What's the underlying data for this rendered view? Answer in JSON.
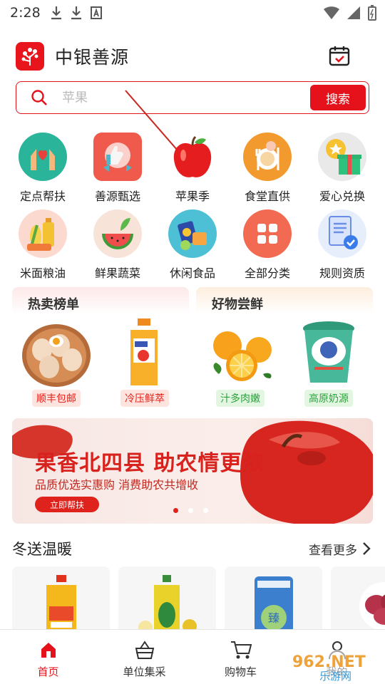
{
  "status_bar": {
    "time": "2:28",
    "icons": [
      "download-icon",
      "download-icon",
      "font-icon",
      "wifi-icon",
      "signal-icon",
      "battery-icon"
    ]
  },
  "header": {
    "title": "中银善源",
    "logo": "tree-logo",
    "action_icon": "calendar-check-icon"
  },
  "search": {
    "placeholder": "苹果",
    "button_label": "搜索"
  },
  "categories": [
    {
      "label": "定点帮扶",
      "icon": "helping-hands-icon"
    },
    {
      "label": "善源甄选",
      "icon": "thumbs-up-badge-icon"
    },
    {
      "label": "苹果季",
      "icon": "apple-icon"
    },
    {
      "label": "食堂直供",
      "icon": "dining-icon"
    },
    {
      "label": "爱心兑换",
      "icon": "gift-icon"
    },
    {
      "label": "米面粮油",
      "icon": "grain-oil-icon"
    },
    {
      "label": "鲜果蔬菜",
      "icon": "watermelon-icon"
    },
    {
      "label": "休闲食品",
      "icon": "snacks-icon"
    },
    {
      "label": "全部分类",
      "icon": "grid-icon"
    },
    {
      "label": "规则资质",
      "icon": "document-check-icon"
    }
  ],
  "promos": [
    {
      "title": "热卖榜单",
      "items": [
        {
          "tag": "顺丰包邮"
        },
        {
          "tag": "冷压鲜萃"
        }
      ]
    },
    {
      "title": "好物尝鲜",
      "items": [
        {
          "tag": "汁多肉嫩"
        },
        {
          "tag": "高原奶源"
        }
      ]
    }
  ],
  "banner": {
    "title": "果香北四县 助农情更浓",
    "subtitle": "品质优选实惠购 消费助农共增收",
    "button": "立即帮扶"
  },
  "section": {
    "title": "冬送温暖",
    "more": "查看更多"
  },
  "tabbar": [
    {
      "label": "首页",
      "icon": "home-icon",
      "active": true
    },
    {
      "label": "单位集采",
      "icon": "basket-icon",
      "active": false
    },
    {
      "label": "购物车",
      "icon": "cart-icon",
      "active": false
    },
    {
      "label": "我的",
      "icon": "user-icon",
      "active": false
    }
  ],
  "watermark": {
    "line1": "962.NET",
    "line2": "乐游网"
  },
  "colors": {
    "accent": "#e5121b",
    "green_tag": "#2aa33b"
  }
}
